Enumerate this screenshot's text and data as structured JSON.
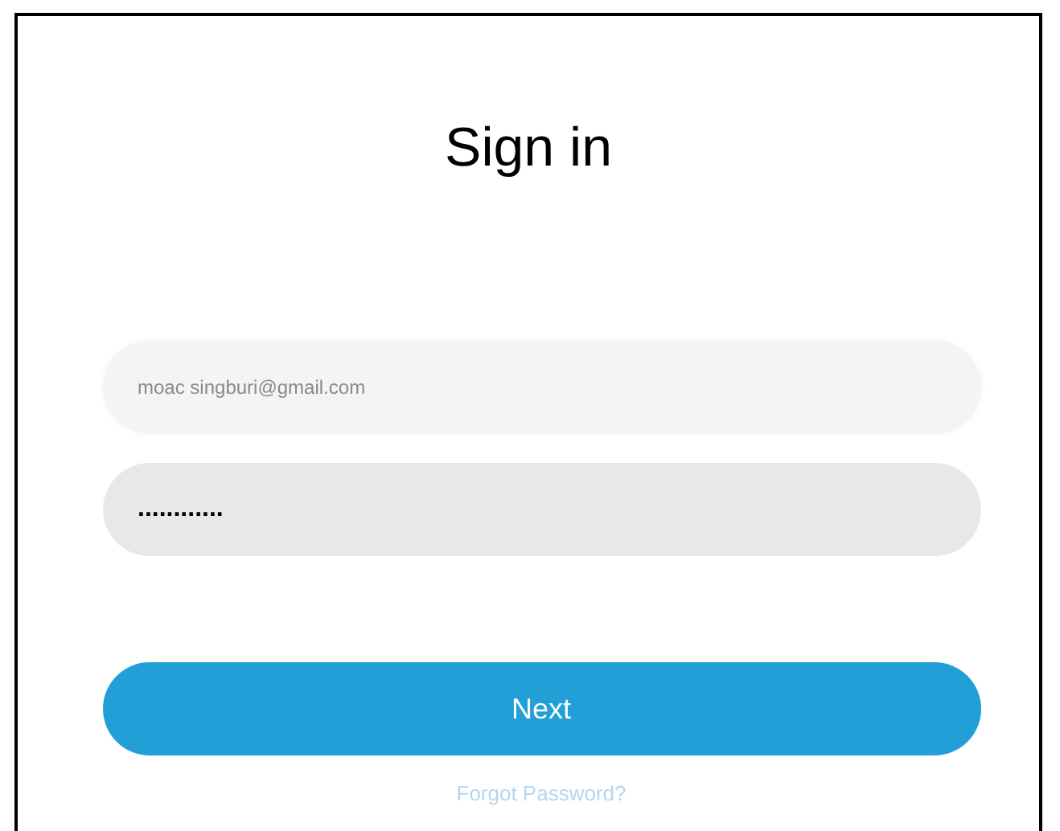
{
  "title": "Sign in",
  "email": {
    "value": "moac singburi@gmail.com"
  },
  "password": {
    "value": "............"
  },
  "next_button": "Next",
  "forgot_link": "Forgot Password?"
}
